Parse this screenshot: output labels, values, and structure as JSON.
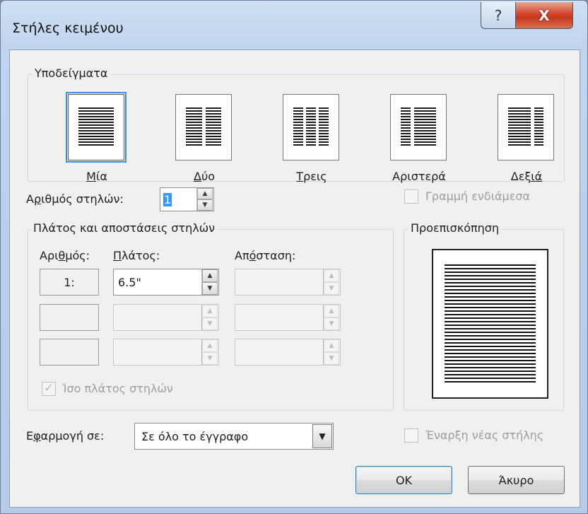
{
  "window": {
    "title": "Στήλες κειμένου",
    "help_glyph": "?",
    "close_glyph": "X"
  },
  "presets": {
    "legend": "Υποδείγματα",
    "items": [
      {
        "key": "M",
        "rest": "ία",
        "selected": true
      },
      {
        "key": "Δ",
        "rest": "ύο",
        "selected": false
      },
      {
        "key": "Τ",
        "rest": "ρεις",
        "selected": false
      },
      {
        "key": "",
        "rest": "Αριστερά",
        "selected": false
      },
      {
        "key": "Δεξ",
        "rest": "ιά",
        "selected": false
      }
    ]
  },
  "columns_count": {
    "label_pre": "Α",
    "label_key": "ρ",
    "label_post": "ιθμός στηλών:",
    "value": "1"
  },
  "line_between": {
    "label": "Γραμμή ενδιάμεσα",
    "checked": false
  },
  "width_spacing": {
    "legend": "Πλάτος και αποστάσεις στηλών",
    "col_number_pre": "Αρι",
    "col_number_key": "θ",
    "col_number_post": "μός:",
    "width_key": "Π",
    "width_rest": "λάτος:",
    "spacing_pre": "Απ",
    "spacing_key": "ό",
    "spacing_post": "σταση:",
    "rows": [
      {
        "num": "1:",
        "width": "6.5\"",
        "spacing": ""
      },
      {
        "num": "",
        "width": "",
        "spacing": ""
      },
      {
        "num": "",
        "width": "",
        "spacing": ""
      }
    ],
    "equal_width_label": "Ίσο πλάτος στηλών",
    "equal_width_checked": true
  },
  "preview": {
    "legend": "Προεπισκόπηση"
  },
  "apply_to": {
    "label_pre": "Ε",
    "label_key": "φ",
    "label_post": "αρμογή σε:",
    "value": "Σε όλο το έγγραφο"
  },
  "new_column": {
    "label": "Έναρξη νέας στήλης",
    "checked": false
  },
  "buttons": {
    "ok": "OK",
    "cancel": "Άκυρο"
  },
  "icons": {
    "spin_up": "▲",
    "spin_down": "▼",
    "dropdown": "▼"
  }
}
